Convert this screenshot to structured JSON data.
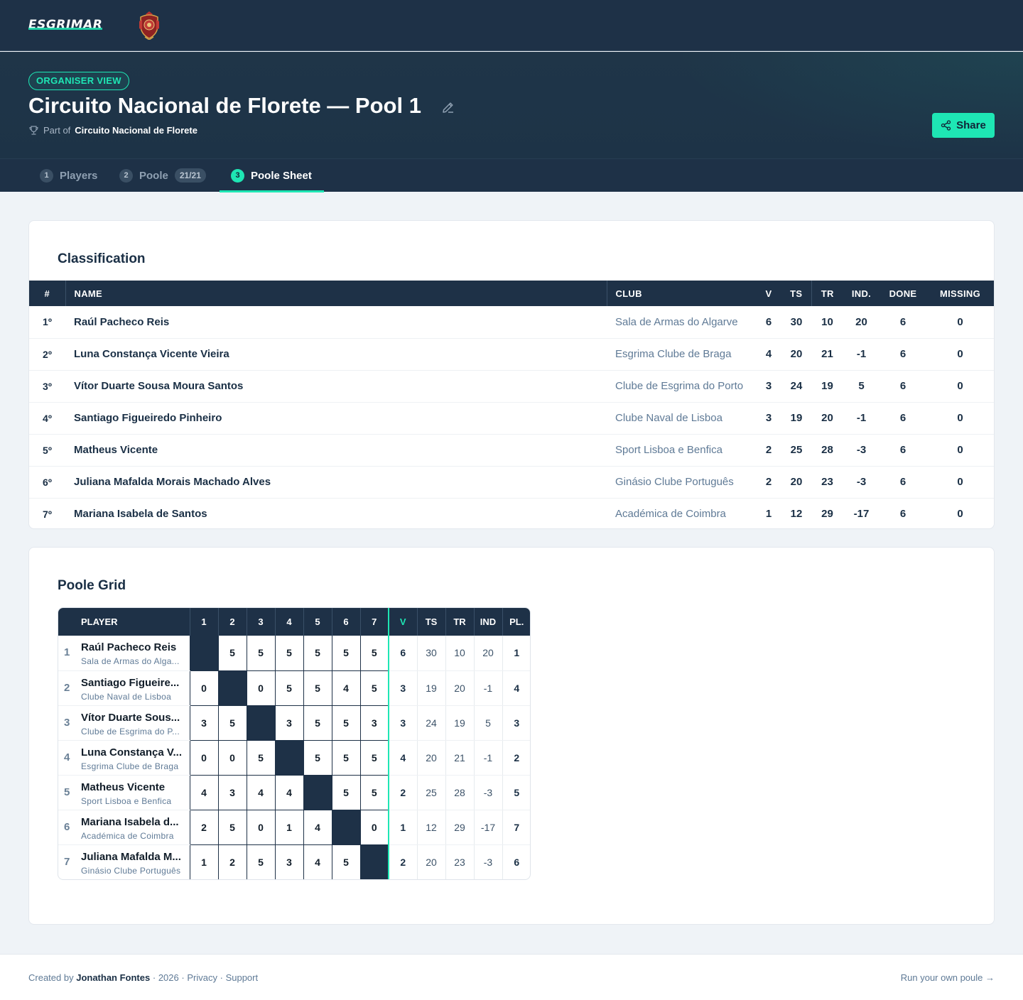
{
  "brand": {
    "name": "ESGRIMAR",
    "crest_icon": "crest-icon"
  },
  "hero": {
    "badge": "ORGANISER VIEW",
    "title": "Circuito Nacional de Florete — Pool 1",
    "part_of_label": "Part of",
    "part_of_value": "Circuito Nacional de Florete",
    "share_label": "Share"
  },
  "tabs": [
    {
      "num": "1",
      "label": "Players"
    },
    {
      "num": "2",
      "label": "Poole",
      "count": "21/21"
    },
    {
      "num": "3",
      "label": "Poole Sheet",
      "active": true
    }
  ],
  "classification": {
    "title": "Classification",
    "headers": [
      "#",
      "NAME",
      "CLUB",
      "V",
      "TS",
      "TR",
      "IND.",
      "DONE",
      "MISSING"
    ],
    "rows": [
      {
        "rank": "1º",
        "name": "Raúl Pacheco Reis",
        "club": "Sala de Armas do Algarve",
        "v": "6",
        "ts": "30",
        "tr": "10",
        "ind": "20",
        "done": "6",
        "missing": "0"
      },
      {
        "rank": "2º",
        "name": "Luna Constança Vicente Vieira",
        "club": "Esgrima Clube de Braga",
        "v": "4",
        "ts": "20",
        "tr": "21",
        "ind": "-1",
        "done": "6",
        "missing": "0"
      },
      {
        "rank": "3º",
        "name": "Vítor Duarte Sousa Moura Santos",
        "club": "Clube de Esgrima do Porto",
        "v": "3",
        "ts": "24",
        "tr": "19",
        "ind": "5",
        "done": "6",
        "missing": "0"
      },
      {
        "rank": "4º",
        "name": "Santiago Figueiredo Pinheiro",
        "club": "Clube Naval de Lisboa",
        "v": "3",
        "ts": "19",
        "tr": "20",
        "ind": "-1",
        "done": "6",
        "missing": "0"
      },
      {
        "rank": "5º",
        "name": "Matheus Vicente",
        "club": "Sport Lisboa e Benfica",
        "v": "2",
        "ts": "25",
        "tr": "28",
        "ind": "-3",
        "done": "6",
        "missing": "0"
      },
      {
        "rank": "6º",
        "name": "Juliana Mafalda Morais Machado Alves",
        "club": "Ginásio Clube Português",
        "v": "2",
        "ts": "20",
        "tr": "23",
        "ind": "-3",
        "done": "6",
        "missing": "0"
      },
      {
        "rank": "7º",
        "name": "Mariana Isabela de Santos",
        "club": "Académica de Coimbra",
        "v": "1",
        "ts": "12",
        "tr": "29",
        "ind": "-17",
        "done": "6",
        "missing": "0"
      }
    ]
  },
  "grid": {
    "title": "Poole Grid",
    "headers": {
      "player": "PLAYER",
      "cols": [
        "1",
        "2",
        "3",
        "4",
        "5",
        "6",
        "7"
      ],
      "stats": [
        "V",
        "TS",
        "TR",
        "IND",
        "PL."
      ]
    },
    "rows": [
      {
        "num": "1",
        "name": "Raúl Pacheco Reis",
        "club": "Sala de Armas do Alga...",
        "scores": [
          "",
          "5",
          "5",
          "5",
          "5",
          "5",
          "5"
        ],
        "v": "6",
        "ts": "30",
        "tr": "10",
        "ind": "20",
        "pl": "1"
      },
      {
        "num": "2",
        "name": "Santiago Figueire...",
        "club": "Clube Naval de Lisboa",
        "scores": [
          "0",
          "",
          "0",
          "5",
          "5",
          "4",
          "5"
        ],
        "v": "3",
        "ts": "19",
        "tr": "20",
        "ind": "-1",
        "pl": "4"
      },
      {
        "num": "3",
        "name": "Vítor Duarte Sous...",
        "club": "Clube de Esgrima do P...",
        "scores": [
          "3",
          "5",
          "",
          "3",
          "5",
          "5",
          "3"
        ],
        "v": "3",
        "ts": "24",
        "tr": "19",
        "ind": "5",
        "pl": "3"
      },
      {
        "num": "4",
        "name": "Luna Constança V...",
        "club": "Esgrima Clube de Braga",
        "scores": [
          "0",
          "0",
          "5",
          "",
          "5",
          "5",
          "5"
        ],
        "v": "4",
        "ts": "20",
        "tr": "21",
        "ind": "-1",
        "pl": "2"
      },
      {
        "num": "5",
        "name": "Matheus Vicente",
        "club": "Sport Lisboa e Benfica",
        "scores": [
          "4",
          "3",
          "4",
          "4",
          "",
          "5",
          "5"
        ],
        "v": "2",
        "ts": "25",
        "tr": "28",
        "ind": "-3",
        "pl": "5"
      },
      {
        "num": "6",
        "name": "Mariana Isabela d...",
        "club": "Académica de Coimbra",
        "scores": [
          "2",
          "5",
          "0",
          "1",
          "4",
          "",
          "0"
        ],
        "v": "1",
        "ts": "12",
        "tr": "29",
        "ind": "-17",
        "pl": "7"
      },
      {
        "num": "7",
        "name": "Juliana Mafalda M...",
        "club": "Ginásio Clube Português",
        "scores": [
          "1",
          "2",
          "5",
          "3",
          "4",
          "5",
          ""
        ],
        "v": "2",
        "ts": "20",
        "tr": "23",
        "ind": "-3",
        "pl": "6"
      }
    ]
  },
  "footer": {
    "created_by": "Created by",
    "author": "Jonathan Fontes",
    "year": "2026",
    "privacy": "Privacy",
    "support": "Support",
    "cta": "Run your own poule →"
  },
  "colors": {
    "navy": "#1e3147",
    "accent": "#1ee6b4",
    "muted": "#5f7a96"
  }
}
